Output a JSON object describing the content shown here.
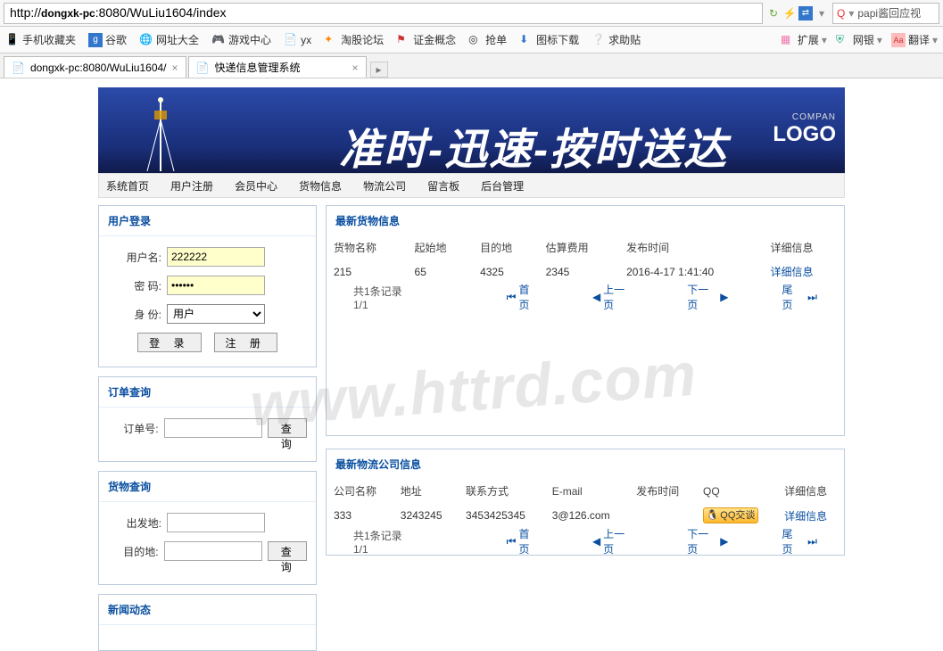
{
  "address_bar": {
    "url_html": "http://dongxk-pc:8080/WuLiu1604/index",
    "search_placeholder": "papi酱回应视"
  },
  "bookmarks": {
    "label": "手机收藏夹",
    "items": [
      "谷歌",
      "网址大全",
      "游戏中心",
      "yx",
      "淘股论坛",
      "证金概念",
      "抢单",
      "图标下载",
      "求助贴"
    ],
    "right": [
      "扩展",
      "网银",
      "翻译"
    ]
  },
  "tabs": [
    {
      "title": "dongxk-pc:8080/WuLiu1604/",
      "active": true
    },
    {
      "title": "快递信息管理系统",
      "active": false
    }
  ],
  "banner": {
    "slogan": "准时-迅速-按时送达",
    "logo_top": "COMPAN",
    "logo_bottom": "LOGO"
  },
  "nav": [
    "系统首页",
    "用户注册",
    "会员中心",
    "货物信息",
    "物流公司",
    "留言板",
    "后台管理"
  ],
  "login": {
    "title": "用户登录",
    "user_label": "用户名:",
    "user_value": "222222",
    "pwd_label": "密  码:",
    "pwd_value": "••••••",
    "role_label": "身  份:",
    "role_value": "用户",
    "login_btn": "登 录",
    "reg_btn": "注 册"
  },
  "order_query": {
    "title": "订单查询",
    "label": "订单号:",
    "btn": "查询"
  },
  "cargo_query": {
    "title": "货物查询",
    "from_label": "出发地:",
    "to_label": "目的地:",
    "btn": "查询"
  },
  "news": {
    "title": "新闻动态"
  },
  "cargo_panel": {
    "title": "最新货物信息",
    "cols": [
      "货物名称",
      "起始地",
      "目的地",
      "估算费用",
      "发布时间",
      "详细信息"
    ],
    "rows": [
      {
        "name": "215",
        "from": "65",
        "to": "4325",
        "cost": "2345",
        "time": "2016-4-17 1:41:40",
        "detail": "详细信息"
      }
    ],
    "pager_info": "共1条记录 1/1",
    "first": "首页",
    "prev": "上一页",
    "next": "下一页",
    "last": "尾 页"
  },
  "company_panel": {
    "title": "最新物流公司信息",
    "cols": [
      "公司名称",
      "地址",
      "联系方式",
      "E-mail",
      "发布时间",
      "QQ",
      "详细信息"
    ],
    "rows": [
      {
        "name": "333",
        "addr": "3243245",
        "contact": "3453425345",
        "email": "3@126.com",
        "time": "",
        "qq": "QQ交谈",
        "detail": "详细信息"
      }
    ],
    "pager_info": "共1条记录 1/1",
    "first": "首页",
    "prev": "上一页",
    "next": "下一页",
    "last": "尾 页"
  },
  "watermark": "www.httrd.com"
}
